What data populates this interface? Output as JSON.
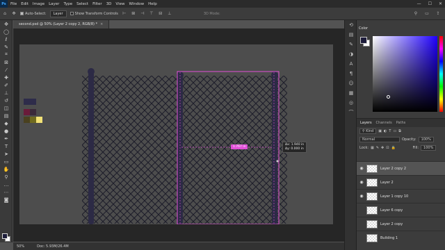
{
  "menubar": {
    "logo": "Ps",
    "items": [
      "File",
      "Edit",
      "Image",
      "Layer",
      "Type",
      "Select",
      "Filter",
      "3D",
      "View",
      "Window",
      "Help"
    ],
    "window_controls": [
      "—",
      "☐",
      "✕"
    ]
  },
  "options": {
    "auto_select_label": "Auto-Select:",
    "auto_select_value": "Layer",
    "show_transform_label": "Show Transform Controls",
    "mode_3d": "3D Mode:"
  },
  "document": {
    "tab_title": "second.psd @ 50% (Layer 2 copy 2, RGB/8) *",
    "close": "×"
  },
  "canvas": {
    "move_badge": "1.767 in",
    "measure_dx": "1.940 in",
    "measure_dy": "0.000 in",
    "colors": {
      "artboard": "#4d4d4d",
      "selection": "#e14fd8",
      "fence_post": "#2c2a45",
      "mesh": "#1d1d2a"
    },
    "swatch_colors": [
      "#2e2c4a",
      "#1f1f33",
      "#6a1b3a",
      "#3a2a3a",
      "#4a4120",
      "#706b1f",
      "#f2e276"
    ]
  },
  "status": {
    "zoom": "50%",
    "doc_info": "Doc: 5.93M/26.4M"
  },
  "color_panel": {
    "tab": "Color"
  },
  "layers_panel": {
    "tabs": [
      "Layers",
      "Channels",
      "Paths"
    ],
    "filter_label": "Kind",
    "blend_mode": "Normal",
    "opacity_label": "Opacity:",
    "opacity_value": "100%",
    "lock_label": "Lock:",
    "fill_label": "Fill:",
    "fill_value": "100%",
    "layers": [
      {
        "name": "Layer 2 copy 2",
        "visible": true,
        "selected": true
      },
      {
        "name": "Layer 2",
        "visible": true,
        "selected": false
      },
      {
        "name": "Layer 1 copy 10",
        "visible": true,
        "selected": false
      },
      {
        "name": "Layer 6 copy",
        "visible": false,
        "selected": false
      },
      {
        "name": "Layer 2 copy",
        "visible": false,
        "selected": false
      },
      {
        "name": "Building 1",
        "visible": false,
        "selected": false
      }
    ]
  }
}
